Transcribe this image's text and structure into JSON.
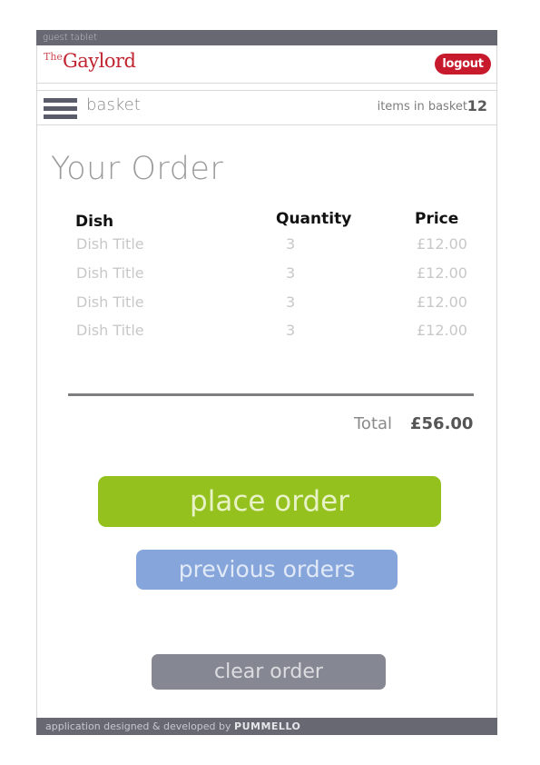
{
  "topbar": {
    "label": "guest tablet"
  },
  "brand": {
    "the": "The",
    "name": "Gaylord"
  },
  "header": {
    "logout_label": "logout"
  },
  "nav": {
    "section_label": "basket",
    "items_label": "items in basket",
    "items_count": "12",
    "menu_icon": "hamburger-menu-icon"
  },
  "order": {
    "title": "Your Order",
    "columns": [
      "Dish",
      "Quantity",
      "Price"
    ],
    "rows": [
      {
        "dish": "Dish Title",
        "quantity": "3",
        "price": "£12.00"
      },
      {
        "dish": "Dish Title",
        "quantity": "3",
        "price": "£12.00"
      },
      {
        "dish": "Dish Title",
        "quantity": "3",
        "price": "£12.00"
      },
      {
        "dish": "Dish Title",
        "quantity": "3",
        "price": "£12.00"
      }
    ],
    "total_label": "Total",
    "total_value": "£56.00"
  },
  "actions": {
    "place_order": "place order",
    "previous_orders": "previous orders",
    "clear_order": "clear order"
  },
  "footer": {
    "text": "application designed & developed by",
    "brand": "PUMMELLO"
  },
  "colors": {
    "accent_red": "#c71b2d",
    "place_green": "#95c11f",
    "previous_blue": "#86a6db",
    "clear_grey": "#858892",
    "bar_grey": "#686873"
  }
}
